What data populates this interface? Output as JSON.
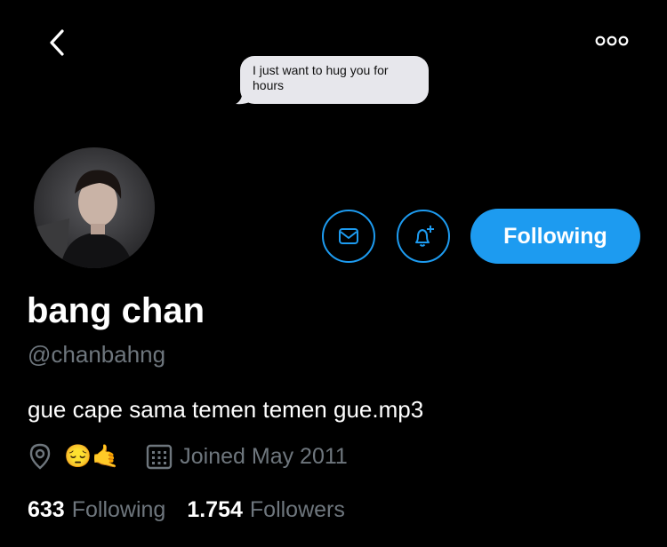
{
  "nav": {
    "back_icon": "chevron-left-icon",
    "more_icon": "more-dots-icon"
  },
  "overlay_message": "I just want to hug you for hours",
  "profile": {
    "name": "bang chan",
    "handle": "@chanbahng",
    "bio": "gue cape sama temen temen gue.mp3",
    "location_icon": "location-pin-icon",
    "location_emojis": "😔🤙",
    "joined_icon": "calendar-icon",
    "joined": "Joined May 2011"
  },
  "actions": {
    "message_icon": "mail-icon",
    "notify_icon": "bell-plus-icon",
    "follow_label": "Following"
  },
  "stats": {
    "following_count": "633",
    "following_label": "Following",
    "followers_count": "1.754",
    "followers_label": "Followers"
  },
  "colors": {
    "accent": "#1d9bf0",
    "background": "#000000",
    "muted": "#6e767d",
    "bubble": "#e7e7ec"
  }
}
